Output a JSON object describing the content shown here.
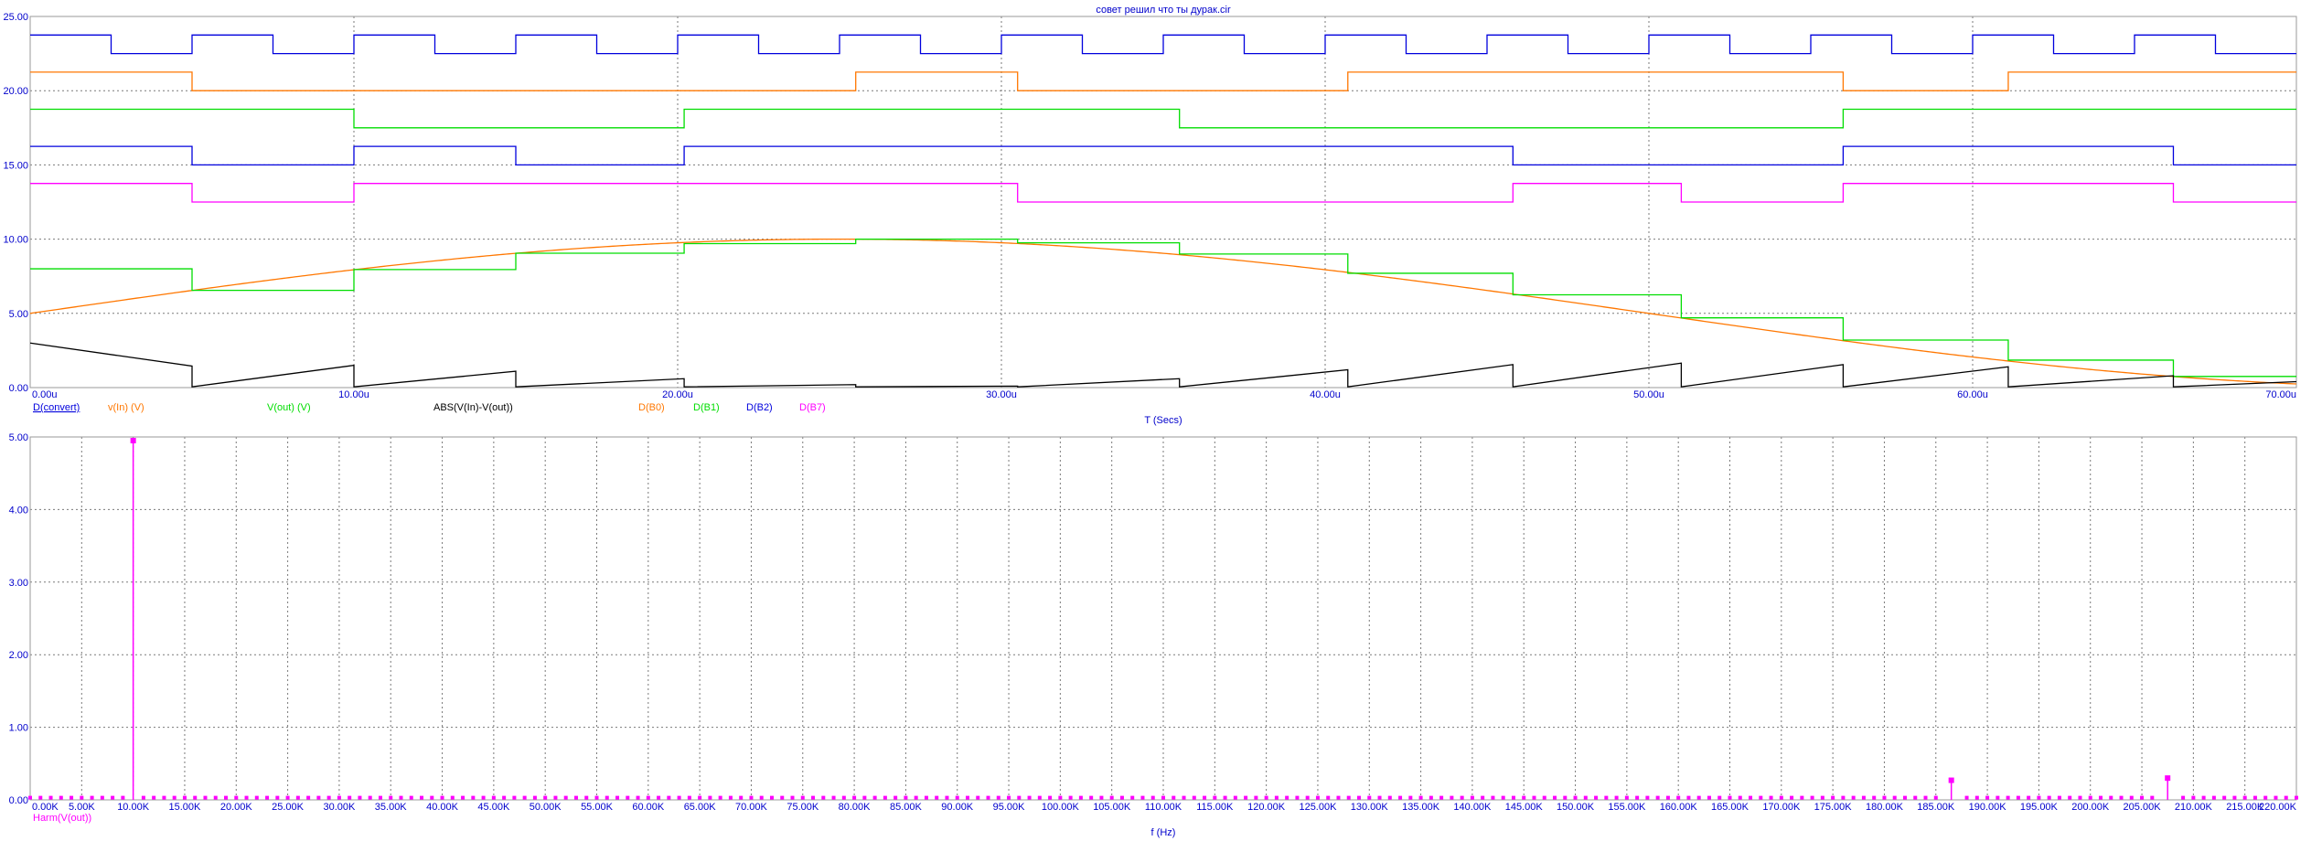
{
  "window_title": "совет решил что ты дурак.cir",
  "colors": {
    "axis_text": "#0000cc",
    "grid": "#7a7a7a",
    "d_convert": "#0000dd",
    "vin": "#ff7700",
    "vout": "#00dd00",
    "abs": "#000000",
    "b0": "#ff7700",
    "b1": "#00dd00",
    "b2": "#0000dd",
    "b7": "#ff00ff",
    "harm": "#ff00ff"
  },
  "chart_data": [
    {
      "type": "line",
      "xlabel": "T (Secs)",
      "xlim": [
        0,
        70
      ],
      "ylim": [
        0,
        25
      ],
      "grid": true,
      "x_ticks": [
        "0.00u",
        "10.00u",
        "20.00u",
        "30.00u",
        "40.00u",
        "50.00u",
        "60.00u",
        "70.00u"
      ],
      "y_ticks": [
        "0.00",
        "5.00",
        "10.00",
        "15.00",
        "20.00",
        "25.00"
      ],
      "legend": [
        "D(convert)",
        "v(In) (V)",
        "V(out) (V)",
        "ABS(V(In)-V(out))",
        "D(B0)",
        "D(B1)",
        "D(B2)",
        "D(B7)"
      ],
      "series": [
        {
          "name": "D(convert)",
          "kind": "digital",
          "base": 22.5,
          "high": 23.75,
          "edges": [
            0,
            2.5,
            5,
            7.5,
            10,
            12.5,
            15,
            17.5,
            20,
            22.5,
            25,
            27.5,
            30,
            32.5,
            35,
            37.5,
            40,
            42.5,
            45,
            47.5,
            50,
            52.5,
            55,
            57.5,
            60,
            62.5,
            65,
            67.5
          ],
          "initial": 1
        },
        {
          "name": "D(B0)",
          "kind": "digital",
          "base": 20.0,
          "high": 21.25,
          "edges": [
            0,
            5,
            25.5,
            30.5,
            40.7,
            56.0,
            61.1
          ],
          "initial": 1
        },
        {
          "name": "D(B1)",
          "kind": "digital",
          "base": 17.5,
          "high": 18.75,
          "edges": [
            0,
            10,
            20.2,
            35.5,
            56.0
          ],
          "initial": 1
        },
        {
          "name": "D(B2)",
          "kind": "digital",
          "base": 15.0,
          "high": 16.25,
          "edges": [
            0,
            5,
            10,
            15,
            20.2,
            45.8,
            56.0,
            66.2
          ],
          "initial": 1
        },
        {
          "name": "D(B7)",
          "kind": "digital",
          "base": 12.5,
          "high": 13.75,
          "edges": [
            0,
            5,
            10,
            30.5,
            45.8,
            51.0,
            56.0,
            66.2
          ],
          "initial": 1
        },
        {
          "name": "v(In) (V)",
          "kind": "sine",
          "offset": 5,
          "amplitude": 5,
          "freq_per_u": 0.01
        },
        {
          "name": "V(out) (V)",
          "kind": "step",
          "x": [
            0,
            5,
            10,
            15,
            20.2,
            25.5,
            30.5,
            35.5,
            40.7,
            45.8,
            51.0,
            56.0,
            61.1,
            66.2,
            70
          ],
          "y": [
            8.0,
            6.55,
            7.95,
            9.05,
            9.7,
            10.0,
            9.75,
            9.0,
            7.7,
            6.25,
            4.7,
            3.2,
            1.85,
            0.75,
            0.75
          ]
        },
        {
          "name": "ABS(V(In)-V(out))",
          "kind": "sawtooth",
          "x": [
            0,
            5,
            10,
            15,
            20.2,
            25.5,
            30.5,
            35.5,
            40.7,
            45.8,
            51.0,
            56.0,
            61.1,
            66.2,
            70
          ],
          "y": [
            3.0,
            1.45,
            1.5,
            1.1,
            0.6,
            0.2,
            0.1,
            0.6,
            1.2,
            1.55,
            1.65,
            1.55,
            1.4,
            0.8,
            0.4
          ]
        }
      ]
    },
    {
      "type": "bar",
      "xlabel": "f (Hz)",
      "xlim": [
        0,
        220
      ],
      "ylim": [
        0,
        5
      ],
      "grid": true,
      "legend": [
        "Harm(V(out))"
      ],
      "x_ticks": [
        "0.00K",
        "5.00K",
        "10.00K",
        "15.00K",
        "20.00K",
        "25.00K",
        "30.00K",
        "35.00K",
        "40.00K",
        "45.00K",
        "50.00K",
        "55.00K",
        "60.00K",
        "65.00K",
        "70.00K",
        "75.00K",
        "80.00K",
        "85.00K",
        "90.00K",
        "95.00K",
        "100.00K",
        "105.00K",
        "110.00K",
        "115.00K",
        "120.00K",
        "125.00K",
        "130.00K",
        "135.00K",
        "140.00K",
        "145.00K",
        "150.00K",
        "155.00K",
        "160.00K",
        "165.00K",
        "170.00K",
        "175.00K",
        "180.00K",
        "185.00K",
        "190.00K",
        "195.00K",
        "200.00K",
        "205.00K",
        "210.00K",
        "215.00K",
        "220.00K"
      ],
      "y_ticks": [
        "0.00",
        "1.00",
        "2.00",
        "3.00",
        "4.00",
        "5.00"
      ],
      "series": [
        {
          "name": "Harm(V(out))",
          "peaks": [
            {
              "x": 10,
              "y": 4.95
            },
            {
              "x": 186.5,
              "y": 0.27
            },
            {
              "x": 207.5,
              "y": 0.3
            }
          ],
          "noise_level": 0.03
        }
      ]
    }
  ]
}
